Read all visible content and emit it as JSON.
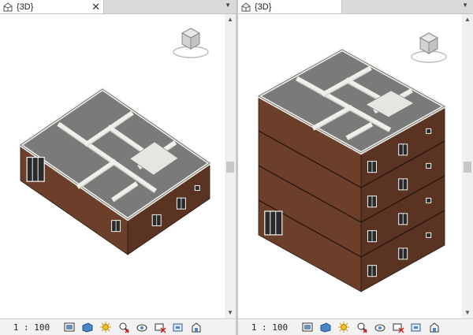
{
  "left_view": {
    "tab_title": "{3D}",
    "tab_close_glyph": "✕",
    "menu_glyph": "▼",
    "scale": "1 : 100",
    "floors": 1
  },
  "right_view": {
    "tab_title": "{3D}",
    "menu_glyph": "▼",
    "scale": "1 : 100",
    "floors": 4
  },
  "scroll": {
    "up_glyph": "▲",
    "down_glyph": "▼"
  },
  "view_cube": {
    "label": "3D view cube"
  },
  "status_icons": [
    "model-graphics-style-icon",
    "shadows-icon",
    "sun-path-icon",
    "temporary-hide-isolate-icon",
    "reveal-hidden-elements-icon",
    "crop-view-icon",
    "show-crop-region-icon",
    "unlock-3d-view-icon"
  ],
  "colors": {
    "brick": "#6b3f2a",
    "brick_dark": "#5a3322",
    "roof": "#7a7a7a",
    "wall": "#f0f0ea",
    "wall_side": "#d4d4cc",
    "window": "#2a2a2a",
    "window_frame": "#f4f4f4"
  }
}
